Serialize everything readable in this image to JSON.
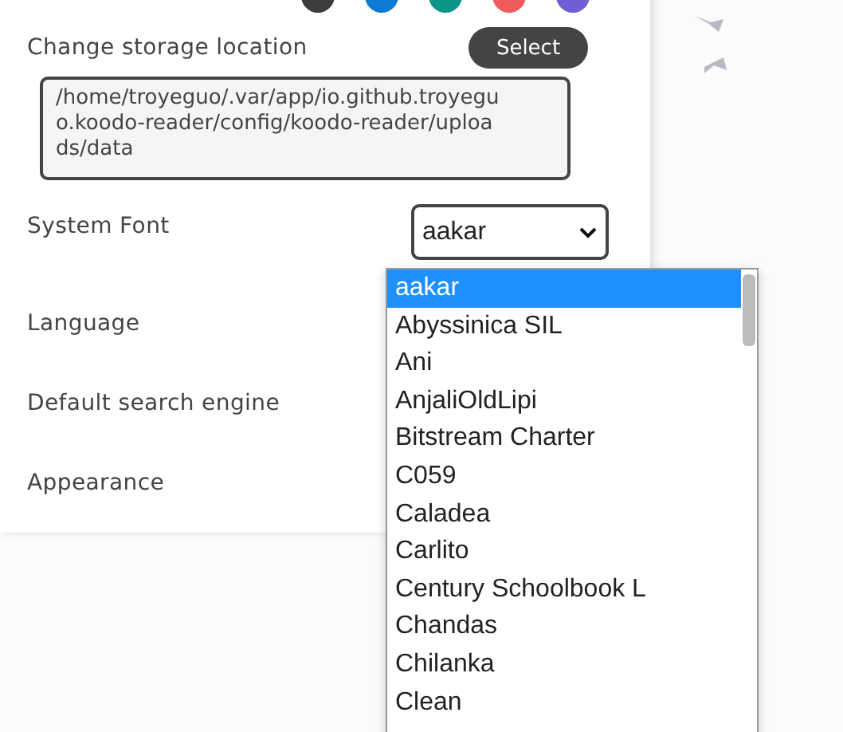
{
  "theme_swatches": [
    {
      "color": "#3d3d3d"
    },
    {
      "color": "#0f7ad6"
    },
    {
      "color": "#0a9688"
    },
    {
      "color": "#f05a5a"
    },
    {
      "color": "#6f5fd6"
    }
  ],
  "settings": [
    {
      "kind": "button",
      "label": "Change storage location",
      "button": "Select",
      "path": "/home/troyeguo/.var/app/io.github.troyeguo.koodo-reader/config/koodo-reader/uploads/data"
    },
    {
      "kind": "select",
      "label": "System Font",
      "value": "aakar"
    },
    {
      "kind": "plain",
      "label": "Language"
    },
    {
      "kind": "plain",
      "label": "Default search engine"
    },
    {
      "kind": "plain",
      "label": "Appearance"
    }
  ],
  "font_list": [
    {
      "label": "aakar",
      "selected": true
    },
    {
      "label": "Abyssinica SIL",
      "selected": false
    },
    {
      "label": "Ani",
      "selected": false
    },
    {
      "label": "AnjaliOldLipi",
      "selected": false
    },
    {
      "label": "Bitstream Charter",
      "selected": false
    },
    {
      "label": "C059",
      "selected": false
    },
    {
      "label": "Caladea",
      "selected": false
    },
    {
      "label": "Carlito",
      "selected": false
    },
    {
      "label": "Century Schoolbook L",
      "selected": false
    },
    {
      "label": "Chandas",
      "selected": false
    },
    {
      "label": "Chilanka",
      "selected": false
    },
    {
      "label": "Clean",
      "selected": false
    }
  ]
}
